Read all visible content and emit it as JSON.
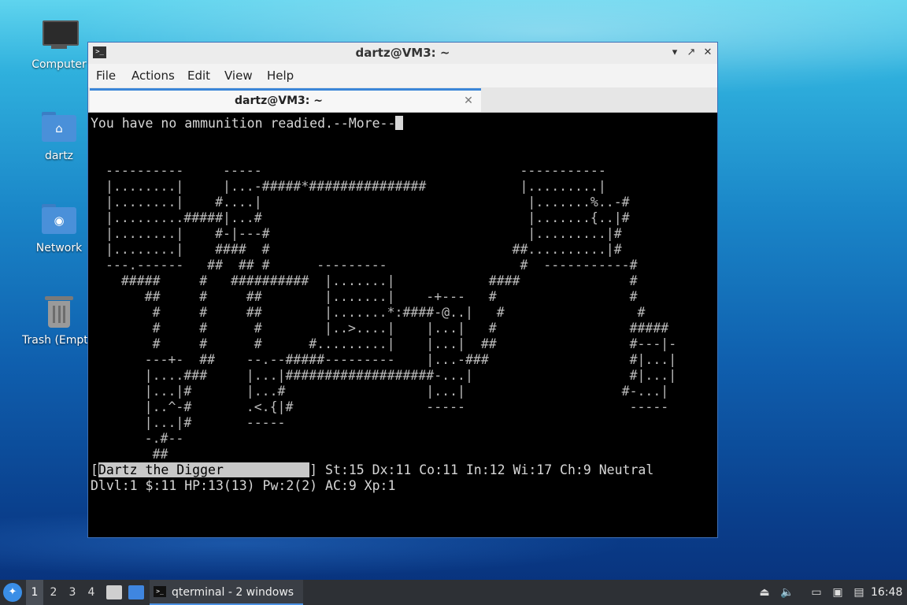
{
  "desktop": {
    "icons": [
      {
        "label": "Computer",
        "icon": "monitor-icon"
      },
      {
        "label": "dartz",
        "icon": "home-folder-icon"
      },
      {
        "label": "Network",
        "icon": "network-folder-icon"
      },
      {
        "label": "Trash (Empty)",
        "icon": "trash-icon"
      }
    ]
  },
  "window": {
    "title": "dartz@VM3: ~",
    "menu": [
      "File",
      "Actions",
      "Edit",
      "View",
      "Help"
    ],
    "tab_label": "dartz@VM3: ~",
    "controls": {
      "minimize": "▾",
      "maximize": "↗",
      "close": "✕"
    }
  },
  "terminal": {
    "message": "You have no ammunition readied.--More--",
    "map": [
      "----------     -----                                 -----------",
      "|........|     |...-#####*###############            |.........|",
      "|........|    #....|                                  |.......%..-#",
      "|.........#####|...#                                  |.......{..|#",
      "|........|    #-|---#                                 |.........|#",
      "|........|    ####  #                               ##..........|#",
      "---.------   ##  ## #      ---------                 #  -----------#",
      "  #####     #   ##########  |.......|            ####              #",
      "     ##     #     ##        |.......|    -+---   #                 #",
      "      #     #     ##        |.......*:####-@..|   #                 #",
      "      #     #      #        |..>....|    |...|   #                 #####",
      "      #     #      #      #.........|    |...|  ##                 #---|-",
      "     ---+-  ##    --.--#####---------    |...-###                  #|...|",
      "     |....###     |...|###################-...|                    #|...|",
      "     |...|#       |...#                  |...|                    #-...|",
      "     |..^-#       .<.{|#                 -----                     -----",
      "     |...|#       -----",
      "     -.#--",
      "      ##"
    ],
    "status_name": "Dartz the Digger",
    "status_stats": " St:15 Dx:11 Co:11 In:12 Wi:17 Ch:9 Neutral",
    "status_line2": "Dlvl:1 $:11 HP:13(13) Pw:2(2) AC:9 Xp:1"
  },
  "taskbar": {
    "workspaces": [
      "1",
      "2",
      "3",
      "4"
    ],
    "active_workspace": "1",
    "task_label": "qterminal - 2 windows",
    "clock": "16:48"
  },
  "colors": {
    "accent": "#3b86d8",
    "terminal_bg": "#000000",
    "terminal_fg": "#d7d7d7",
    "door_orange": "#e08a3c",
    "object_purple": "#8a5cff",
    "tree_cyan": "#3ac4c4"
  }
}
